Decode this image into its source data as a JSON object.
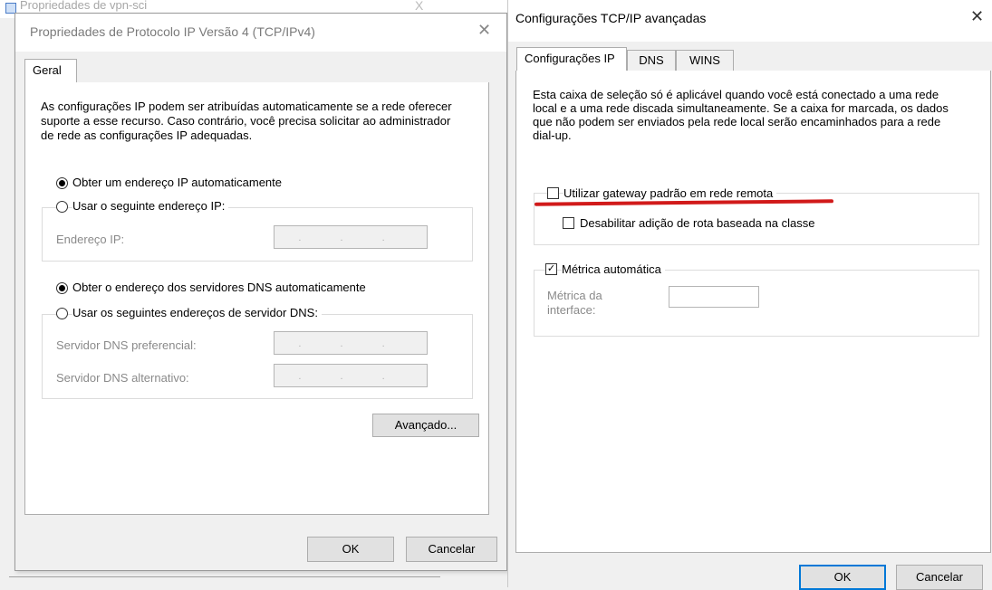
{
  "background_window": {
    "title": "Propriedades de vpn-sci",
    "close_glyph": "X"
  },
  "left_dialog": {
    "title": "Propriedades de Protocolo IP Versão 4 (TCP/IPv4)",
    "close_glyph": "✕",
    "tabs": [
      {
        "label": "Geral"
      }
    ],
    "description": "As configurações IP podem ser atribuídas automaticamente se a rede oferecer suporte a esse recurso. Caso contrário, você precisa solicitar ao administrador de rede as configurações IP adequadas.",
    "ip": {
      "auto_label": "Obter um endereço IP automaticamente",
      "auto_selected": true,
      "manual_label": "Usar o seguinte endereço IP:",
      "address_label": "Endereço IP:",
      "address_value": ". . ."
    },
    "dns": {
      "auto_label": "Obter o endereço dos servidores DNS automaticamente",
      "auto_selected": true,
      "manual_label": "Usar os seguintes endereços de servidor DNS:",
      "preferred_label": "Servidor DNS preferencial:",
      "preferred_value": ". . .",
      "alternate_label": "Servidor DNS alternativo:",
      "alternate_value": ". . ."
    },
    "advanced_button": "Avançado...",
    "ok_button": "OK",
    "cancel_button": "Cancelar"
  },
  "right_dialog": {
    "title": "Configurações TCP/IP avançadas",
    "close_glyph": "✕",
    "tabs": [
      {
        "label": "Configurações IP",
        "active": true
      },
      {
        "label": "DNS",
        "active": false
      },
      {
        "label": "WINS",
        "active": false
      }
    ],
    "description": "Esta caixa de seleção só é aplicável quando você está conectado a uma rede local e a uma rede discada simultaneamente. Se a caixa for marcada, os dados que não podem ser enviados pela rede local serão encaminhados para a rede dial-up.",
    "gateway_checkbox": {
      "label": "Utilizar gateway padrão em rede remota",
      "checked": false
    },
    "class_route_checkbox": {
      "label": "Desabilitar adição de rota baseada na classe",
      "checked": false
    },
    "auto_metric_checkbox": {
      "label": "Métrica automática",
      "checked": true
    },
    "interface_metric_label": "Métrica da interface:",
    "interface_metric_value": "",
    "ok_button": "OK",
    "cancel_button": "Cancelar",
    "highlight_color": "#d11a1a"
  }
}
